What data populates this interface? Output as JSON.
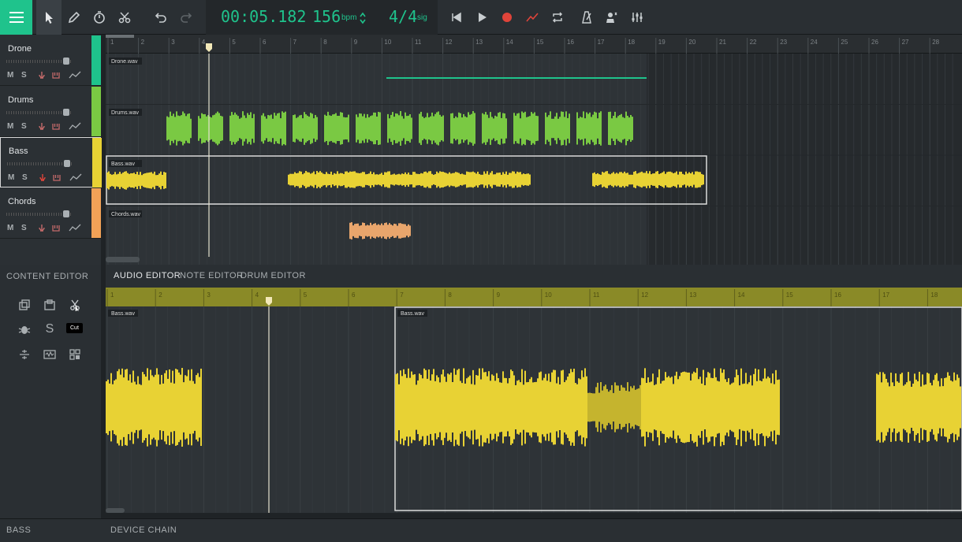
{
  "toolbar": {
    "tools": [
      {
        "name": "pointer-icon",
        "active": true
      },
      {
        "name": "pencil-icon",
        "active": false
      },
      {
        "name": "stopwatch-icon",
        "active": false
      },
      {
        "name": "scissors-icon",
        "active": false
      },
      {
        "name": "undo-icon",
        "active": false
      },
      {
        "name": "redo-icon",
        "active": false
      }
    ],
    "time": "00:05.182",
    "bpm": "156",
    "bpm_unit": "bpm",
    "signature": "4/4",
    "signature_unit": "sig",
    "transport": [
      "skip-back-icon",
      "play-icon",
      "record-icon",
      "automation-icon",
      "loop-icon",
      "metronome-icon",
      "count-in-icon",
      "mixer-icon"
    ],
    "accent_color": "#1fc38c",
    "record_color": "#e0443a"
  },
  "timeline": {
    "ruler_labels": [
      "1",
      "2",
      "3",
      "4",
      "5",
      "6",
      "7",
      "8",
      "9",
      "10",
      "11",
      "12",
      "13",
      "14",
      "15",
      "16",
      "17",
      "18",
      "19",
      "20",
      "21",
      "22",
      "23",
      "24",
      "25",
      "26",
      "27",
      "28"
    ]
  },
  "tracks": [
    {
      "name": "Drone",
      "color": "#1fc38c",
      "clip": "Drone.wav",
      "fader": 0.95,
      "buttons": [
        "M",
        "S"
      ]
    },
    {
      "name": "Drums",
      "color": "#7ac943",
      "clip": "Drums.wav",
      "fader": 0.95,
      "buttons": [
        "M",
        "S"
      ]
    },
    {
      "name": "Bass",
      "color": "#e8d234",
      "clip": "Bass.wav",
      "fader": 0.95,
      "buttons": [
        "M",
        "S"
      ],
      "selected": true
    },
    {
      "name": "Chords",
      "color": "#f2a257",
      "clip": "Chords.wav",
      "fader": 0.95,
      "buttons": [
        "M",
        "S"
      ]
    }
  ],
  "content_editor": {
    "title": "CONTENT EDITOR",
    "icons": [
      "duplicate-icon",
      "paste-icon",
      "cut-icon",
      "bug-icon",
      "s-icon",
      "split-icon",
      "bounce-icon",
      "quantize-icon"
    ],
    "s_label": "S",
    "tooltip": "Cut"
  },
  "editor_tabs": [
    "AUDIO EDITOR",
    "NOTE EDITOR",
    "DRUM EDITOR"
  ],
  "audio_editor": {
    "ruler_labels": [
      "1",
      "2",
      "3",
      "4",
      "5",
      "6",
      "7",
      "8",
      "9",
      "10",
      "11",
      "12",
      "13",
      "14",
      "15",
      "16",
      "17",
      "18"
    ],
    "clips": [
      "Bass.wav",
      "Bass.wav"
    ],
    "color": "#e8d234"
  },
  "bottom": {
    "left": "BASS",
    "right": "DEVICE CHAIN"
  }
}
